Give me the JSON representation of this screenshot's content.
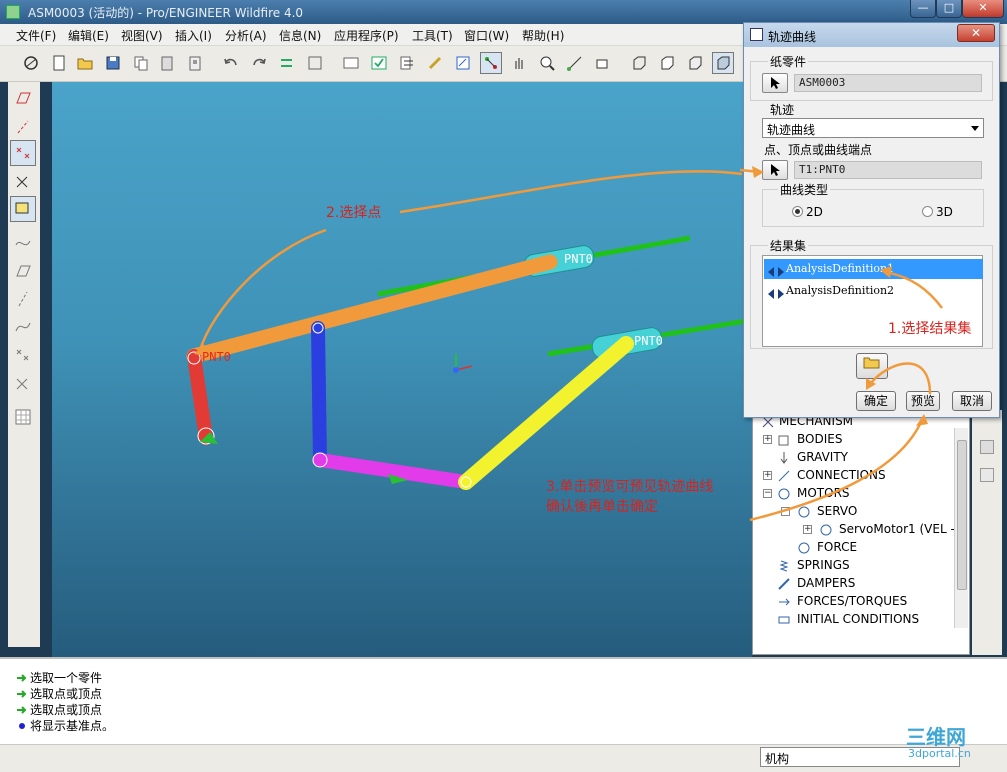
{
  "window": {
    "title": "ASM0003 (活动的) - Pro/ENGINEER Wildfire 4.0",
    "min_label": "—",
    "max_label": "□",
    "close_label": "✕"
  },
  "menu": [
    "文件(F)",
    "编辑(E)",
    "视图(V)",
    "插入(I)",
    "分析(A)",
    "信息(N)",
    "应用程序(P)",
    "工具(T)",
    "窗口(W)",
    "帮助(H)"
  ],
  "annotations": {
    "select_point": "2.选择点",
    "select_result_set": "1.选择结果集",
    "preview_line1": "3.单击预览可预见轨迹曲线",
    "preview_line2": "确认後再单击确定"
  },
  "viewport": {
    "pnt_upper": "PNT0",
    "pnt_lower": "PNT0",
    "pnt_left": "PNT0"
  },
  "dialog": {
    "title": "轨迹曲线",
    "close_label": "✕",
    "paper_part_label": "纸零件",
    "paper_part_value": "ASM0003",
    "trajectory_label": "轨迹",
    "trajectory_value": "轨迹曲线",
    "point_label": "点、顶点或曲线端点",
    "point_value": "T1:PNT0",
    "curve_type_label": "曲线类型",
    "radio_2d": "2D",
    "radio_3d": "3D",
    "result_set_label": "结果集",
    "result_items": [
      "AnalysisDefinition1",
      "AnalysisDefinition2"
    ],
    "ok_label": "确定",
    "preview_label": "预览",
    "cancel_label": "取消"
  },
  "model_tree": {
    "items": [
      {
        "label": "MECHANISM"
      },
      {
        "label": "BODIES"
      },
      {
        "label": "GRAVITY"
      },
      {
        "label": "CONNECTIONS"
      },
      {
        "label": "MOTORS"
      },
      {
        "label": "SERVO"
      },
      {
        "label": "ServoMotor1 (VEL -"
      },
      {
        "label": "FORCE"
      },
      {
        "label": "SPRINGS"
      },
      {
        "label": "DAMPERS"
      },
      {
        "label": "FORCES/TORQUES"
      },
      {
        "label": "INITIAL CONDITIONS"
      }
    ]
  },
  "messages": [
    "选取一个零件",
    "选取点或顶点",
    "选取点或顶点",
    "将显示基准点。"
  ],
  "status": {
    "filter_value": "机构"
  },
  "watermark": {
    "brand": "三维网",
    "url": "3dportal.cn"
  },
  "colors": {
    "link_orange": "#f19a3b",
    "link_red": "#e23b35",
    "link_blue": "#2b3fe0",
    "link_magenta": "#e13bea",
    "link_yellow": "#f2f22f",
    "rail_green": "#21c11c",
    "annotation_red": "#d8231d",
    "selection_blue": "#3399ff"
  }
}
